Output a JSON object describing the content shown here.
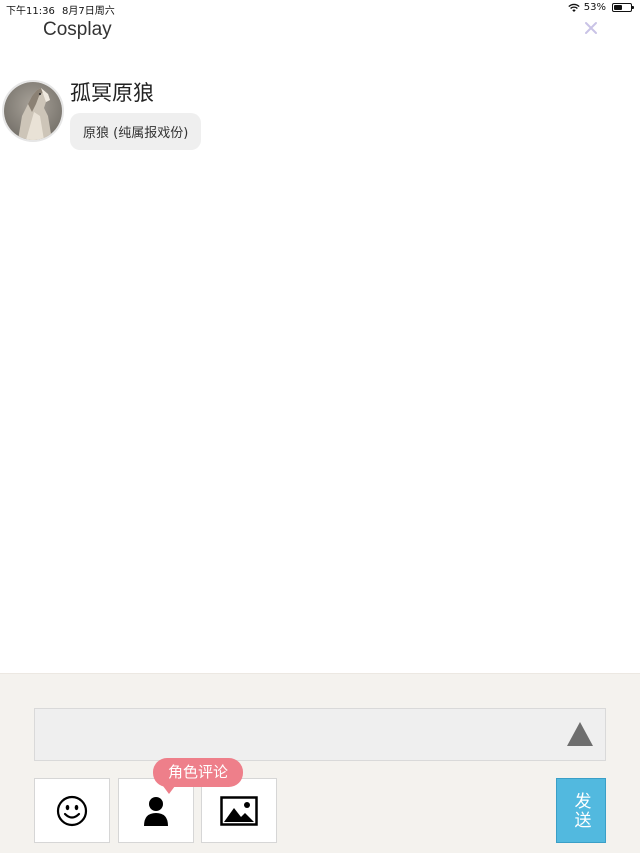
{
  "status_bar": {
    "time": "下午11:36",
    "date": "8月7日周六",
    "battery_text": "53%",
    "battery_level": 0.53,
    "wifi_icon": "wifi-icon"
  },
  "header": {
    "title": "Cosplay",
    "close_icon": "close-icon",
    "close_color": "#c9c3e6"
  },
  "message": {
    "sender_name": "孤冥原狼",
    "text": "原狼 (纯属报戏份)",
    "avatar_icon": "wolf-avatar"
  },
  "composer": {
    "input_value": "",
    "send_icon": "triangle-up-icon",
    "emoji_icon": "smiley-icon",
    "role_icon": "person-icon",
    "image_icon": "image-icon",
    "role_tooltip": "角色评论",
    "submit_label": "发送",
    "accent_color": "#52b9df",
    "tooltip_color": "#ee7f8a"
  }
}
